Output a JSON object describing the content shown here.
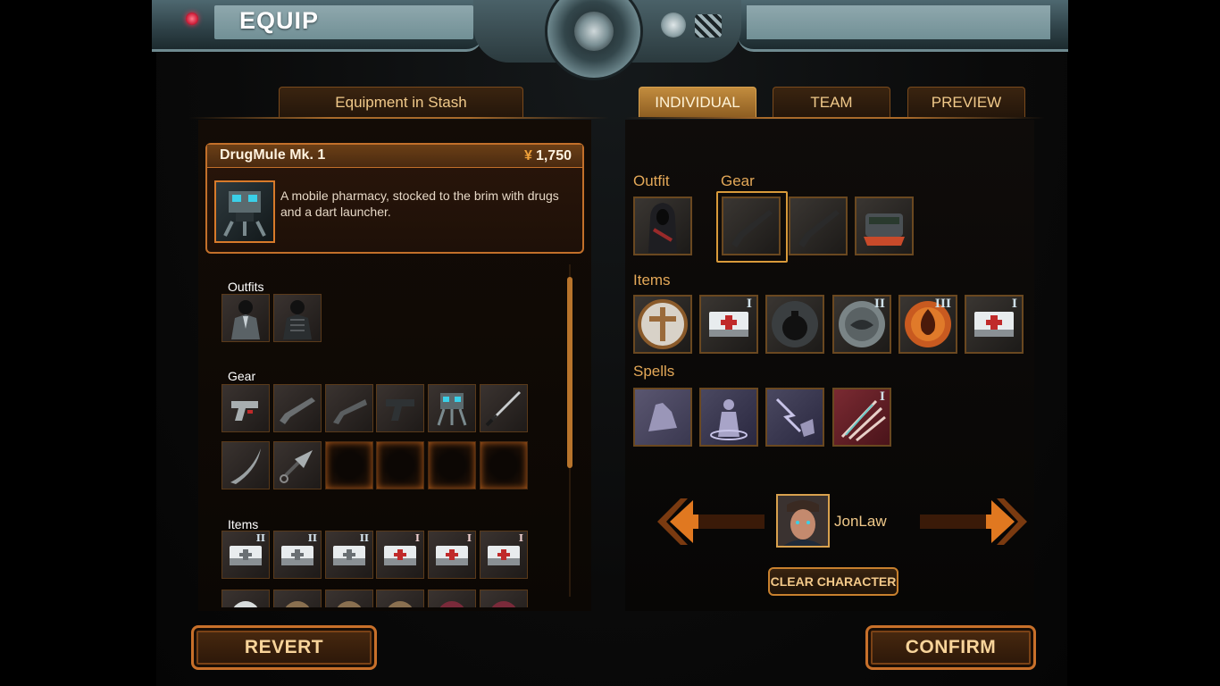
{
  "header": {
    "title": "EQUIP"
  },
  "left_tab": {
    "label": "Equipment in Stash"
  },
  "right_tabs": [
    {
      "label": "INDIVIDUAL",
      "active": true
    },
    {
      "label": "TEAM",
      "active": false
    },
    {
      "label": "PREVIEW",
      "active": false
    }
  ],
  "selected_item": {
    "name": "DrugMule Mk. 1",
    "currency_symbol": "¥",
    "price": "1,750",
    "description": "A mobile pharmacy, stocked to the brim with drugs and a dart launcher.",
    "icon": "drug-mule-drone-icon"
  },
  "stash": {
    "outfits_label": "Outfits",
    "gear_label": "Gear",
    "items_label": "Items",
    "outfits": [
      {
        "icon": "suit-outfit-icon"
      },
      {
        "icon": "armored-outfit-icon"
      }
    ],
    "gear_row1": [
      {
        "icon": "pistol-icon"
      },
      {
        "icon": "shotgun-icon"
      },
      {
        "icon": "sawed-off-shotgun-icon"
      },
      {
        "icon": "handgun-icon"
      },
      {
        "icon": "drone-icon"
      },
      {
        "icon": "katana-icon"
      }
    ],
    "gear_row2": [
      {
        "icon": "blade-icon"
      },
      {
        "icon": "kunai-icon"
      },
      {
        "icon": "empty-slot"
      },
      {
        "icon": "empty-slot"
      },
      {
        "icon": "empty-slot"
      },
      {
        "icon": "empty-slot"
      }
    ],
    "items": [
      {
        "icon": "medkit-icon",
        "tier": "II"
      },
      {
        "icon": "medkit-icon",
        "tier": "II"
      },
      {
        "icon": "medkit-icon",
        "tier": "II"
      },
      {
        "icon": "medkit-red-icon",
        "tier": "I"
      },
      {
        "icon": "medkit-red-icon",
        "tier": "I"
      },
      {
        "icon": "medkit-red-icon",
        "tier": "I"
      }
    ]
  },
  "loadout": {
    "outfit_label": "Outfit",
    "gear_label": "Gear",
    "items_label": "Items",
    "spells_label": "Spells",
    "outfit": {
      "icon": "hooded-outfit-icon"
    },
    "gear": [
      {
        "icon": "shotgun-icon"
      },
      {
        "icon": "shotgun-icon"
      },
      {
        "icon": "drug-mule-drone-icon"
      }
    ],
    "items": [
      {
        "icon": "caduceus-medkit-icon",
        "tier": ""
      },
      {
        "icon": "medkit-red-icon",
        "tier": "I"
      },
      {
        "icon": "grenade-icon",
        "tier": ""
      },
      {
        "icon": "rock-grenade-icon",
        "tier": "II"
      },
      {
        "icon": "fire-grenade-icon",
        "tier": "III"
      },
      {
        "icon": "medkit-red-icon",
        "tier": "I"
      }
    ],
    "spells": [
      {
        "icon": "palm-spell-icon",
        "tier": ""
      },
      {
        "icon": "figure-aura-spell-icon",
        "tier": ""
      },
      {
        "icon": "lightning-hand-spell-icon",
        "tier": ""
      },
      {
        "icon": "claw-slash-spell-icon",
        "tier": "I"
      }
    ]
  },
  "character": {
    "name": "JonLaw",
    "icon": "character-portrait"
  },
  "buttons": {
    "clear_character": "CLEAR CHARACTER",
    "revert": "REVERT",
    "confirm": "CONFIRM"
  },
  "colors": {
    "accent": "#c8702a",
    "tab_active": "#c28c3e",
    "label": "#e3a858"
  }
}
